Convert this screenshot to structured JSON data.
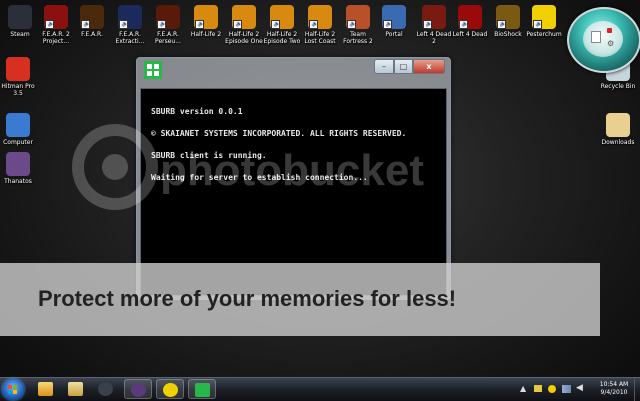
{
  "desktop_icons": [
    {
      "label": "Steam",
      "color": "#2a2f3a"
    },
    {
      "label": "F.E.A.R. 2 Project...",
      "color": "#8b1010"
    },
    {
      "label": "F.E.A.R.",
      "color": "#4a2a0a"
    },
    {
      "label": "F.E.A.R. Extracti...",
      "color": "#1a2a5a"
    },
    {
      "label": "F.E.A.R. Perseu...",
      "color": "#5a1a0a"
    },
    {
      "label": "Half-Life 2",
      "color": "#d88a10"
    },
    {
      "label": "Half-Life 2 Episode One",
      "color": "#d88a10"
    },
    {
      "label": "Half-Life 2 Episode Two",
      "color": "#d88a10"
    },
    {
      "label": "Half-Life 2 Lost Coast",
      "color": "#d88a10"
    },
    {
      "label": "Team Fortress 2",
      "color": "#b8502a"
    },
    {
      "label": "Portal",
      "color": "#3a6ab0"
    },
    {
      "label": "Left 4 Dead 2",
      "color": "#7a1a10"
    },
    {
      "label": "Left 4 Dead",
      "color": "#9a0a0a"
    },
    {
      "label": "BioShock",
      "color": "#7a5a10"
    },
    {
      "label": "Pesterchum",
      "color": "#f0d000"
    }
  ],
  "left_icons": [
    {
      "label": "Hitman Pro 3.5",
      "color": "#d83020"
    },
    {
      "label": "Computer",
      "color": "#3a7ad0"
    },
    {
      "label": "Thanatos",
      "color": "#6a4a8a"
    }
  ],
  "right_icons": [
    {
      "label": "Recycle Bin",
      "color": "#c8d4dc"
    },
    {
      "label": "Downloads",
      "color": "#e8d090"
    }
  ],
  "window": {
    "lines": [
      "SBURB version 0.0.1",
      "© SKAIANET SYSTEMS INCORPORATED. ALL RIGHTS RESERVED.",
      "SBURB client is running.",
      "Waiting for server to establish connection..."
    ],
    "minimize_glyph": "–",
    "maximize_glyph": "□",
    "close_glyph": "x"
  },
  "watermark": {
    "text": "photobucket",
    "banner": "Protect more of your memories for less!"
  },
  "taskbar": {
    "time": "10:54 AM",
    "date": "9/4/2010"
  }
}
